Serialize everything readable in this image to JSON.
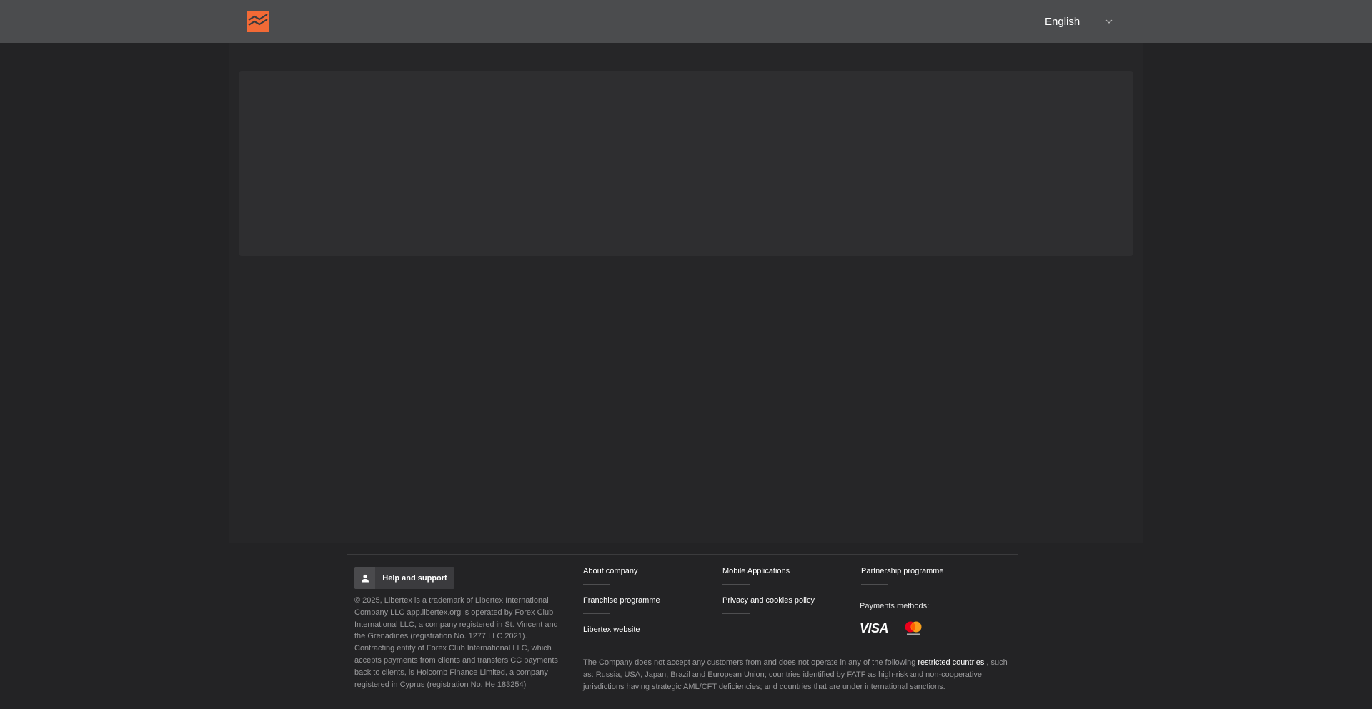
{
  "header": {
    "logo_icon": "libertex-logo-icon",
    "brand_color": "#f26a36",
    "language": "English",
    "language_chevron_icon": "chevron-down-icon"
  },
  "footer": {
    "help_button": {
      "label": "Help and support",
      "icon": "person-icon"
    },
    "legal_text": "© 2025, Libertex is a trademark of Libertex International Company LLC app.libertex.org is operated by Forex Club International LLC, a company registered in St. Vincent and the Grenadines (registration No. 1277 LLC 2021). Contracting entity of Forex Club International LLC, which accepts payments from clients and transfers CC payments back to clients, is Holcomb Finance Limited, a company registered in Cyprus (registration No. He 183254)",
    "links": {
      "about_company": "About company",
      "mobile_applications": "Mobile Applications",
      "partnership_programme": "Partnership programme",
      "franchise_programme": "Franchise programme",
      "privacy_policy": "Privacy and cookies policy",
      "libertex_website": "Libertex website"
    },
    "payments": {
      "title": "Payments methods:",
      "visa": "VISA",
      "mastercard_icon": "mastercard-icon"
    },
    "disclaimer": {
      "before": "The Company does not accept any customers from and does not operate in any of the following ",
      "link": "restricted countries",
      "after": " , such as: Russia, USA, Japan, Brazil and European Union; countries identified by FATF as high-risk and non-cooperative jurisdictions having strategic AML/CFT deficiencies; and countries that are under international sanctions."
    }
  }
}
